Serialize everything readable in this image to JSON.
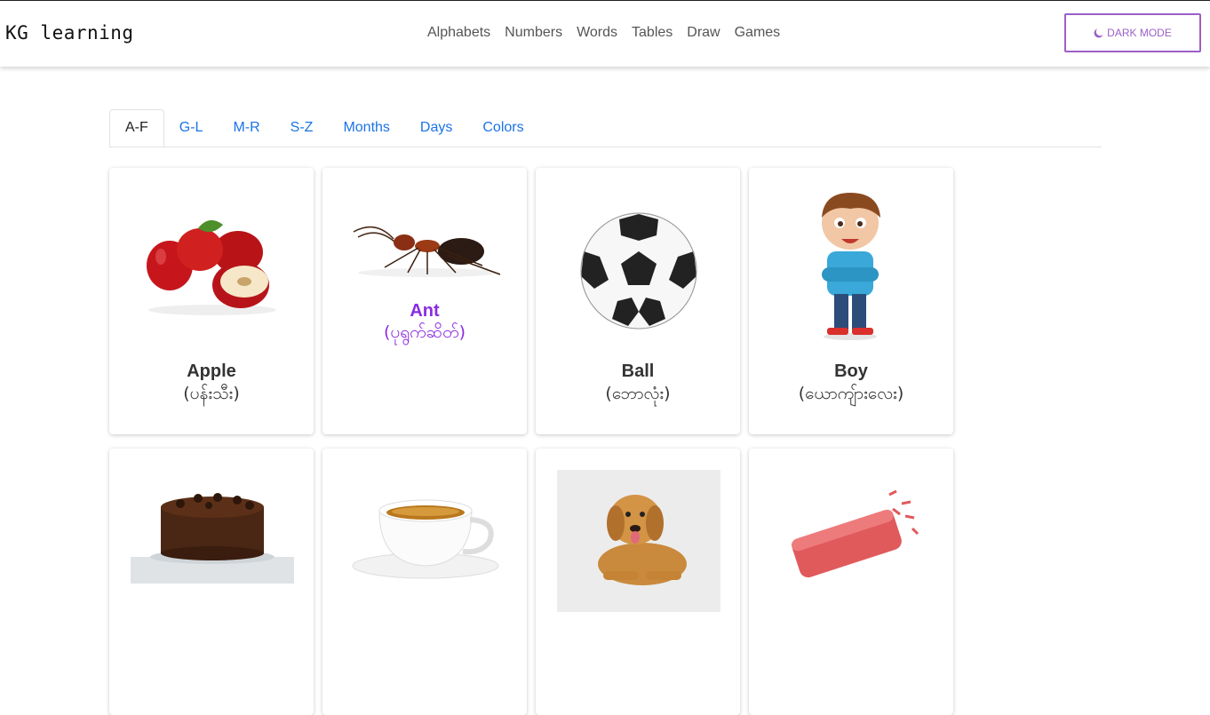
{
  "brand": "KG learning",
  "nav": {
    "links": [
      "Alphabets",
      "Numbers",
      "Words",
      "Tables",
      "Draw",
      "Games"
    ],
    "dark_mode_label": "DARK MODE",
    "dark_mode_icon": "moon-icon"
  },
  "tabs": [
    "A-F",
    "G-L",
    "M-R",
    "S-Z",
    "Months",
    "Days",
    "Colors"
  ],
  "active_tab": "A-F",
  "accent_color": "#9c5fc7",
  "link_color": "#1a73e8",
  "highlight_color": "#8a2be2",
  "cards": [
    {
      "word": "Apple",
      "translation": "(ပန်းသီး)",
      "icon": "apple-icon"
    },
    {
      "word": "Ant",
      "translation": "(ပုရွက်ဆိတ်)",
      "icon": "ant-icon"
    },
    {
      "word": "Ball",
      "translation": "(ဘောလုံး)",
      "icon": "soccer-ball-icon"
    },
    {
      "word": "Boy",
      "translation": "(ယောကျ်ားလေး)",
      "icon": "boy-icon"
    }
  ],
  "row2_icons": [
    "cake-icon",
    "coffee-cup-icon",
    "dog-icon",
    "eraser-icon"
  ]
}
